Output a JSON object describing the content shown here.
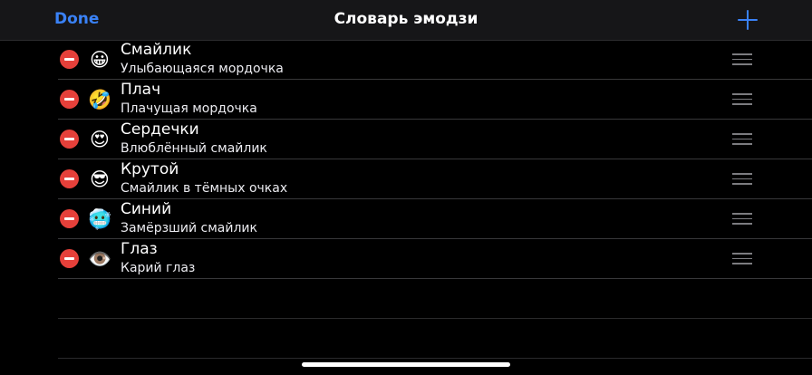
{
  "navbar": {
    "done_label": "Done",
    "title": "Словарь эмодзи",
    "add_icon": "plus-icon"
  },
  "colors": {
    "accent": "#3a82f7",
    "delete": "#e5403a",
    "background": "#000000"
  },
  "rows": [
    {
      "emoji": "😀",
      "title": "Смайлик",
      "subtitle": "Улыбающаяся мордочка"
    },
    {
      "emoji": "🤣",
      "title": "Плач",
      "subtitle": "Плачущая мордочка"
    },
    {
      "emoji": "😍",
      "title": "Сердечки",
      "subtitle": "Влюблённый смайлик"
    },
    {
      "emoji": "😎",
      "title": "Крутой",
      "subtitle": "Смайлик в тёмных очках"
    },
    {
      "emoji": "🥶",
      "title": "Синий",
      "subtitle": "Замёрзший смайлик"
    },
    {
      "emoji": "👁️",
      "title": "Глаз",
      "subtitle": "Карий глаз"
    }
  ]
}
